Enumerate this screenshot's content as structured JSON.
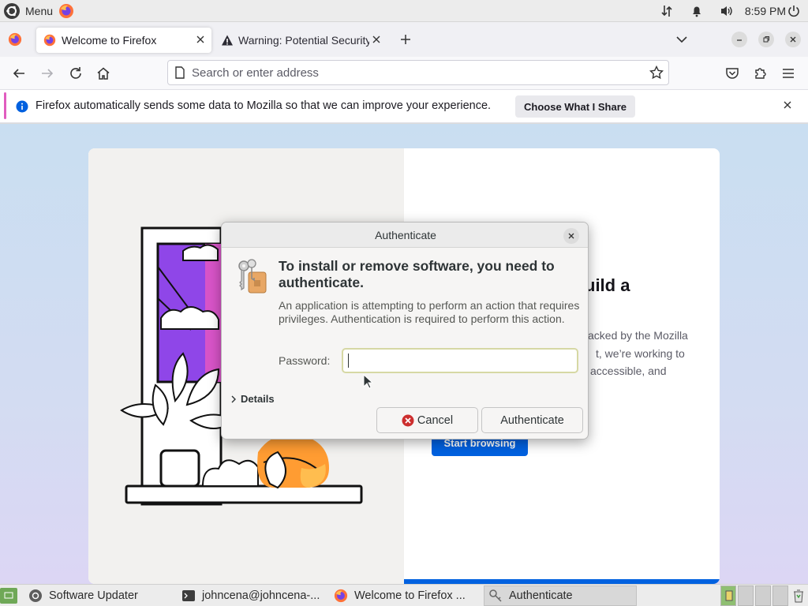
{
  "top_panel": {
    "menu_label": "Menu",
    "clock": "8:59 PM",
    "icons": [
      "ubuntu-menu-icon",
      "firefox-icon",
      "network-icon",
      "notification-bell-icon",
      "volume-icon",
      "power-icon"
    ]
  },
  "tabs": [
    {
      "title": "Welcome to Firefox",
      "active": true,
      "icon": "firefox-icon"
    },
    {
      "title": "Warning: Potential Security Risk Ahead",
      "active": false,
      "icon": "warning-icon"
    }
  ],
  "nav": {
    "url_placeholder": "Search or enter address"
  },
  "notification": {
    "message": "Firefox automatically sends some data to Mozilla so that we can improve your experience.",
    "button": "Choose What I Share"
  },
  "welcome_page": {
    "heading_fragment": "uild a",
    "body_lines": [
      "acked by the Mozilla",
      "t, we’re working to",
      "accessible, and"
    ],
    "start_button": "Start browsing"
  },
  "dialog": {
    "title": "Authenticate",
    "heading": "To install or remove software, you need to authenticate.",
    "description": "An application is attempting to perform an action that requires privileges. Authentication is required to perform this action.",
    "password_label": "Password:",
    "password_value": "",
    "details_label": "Details",
    "cancel_label": "Cancel",
    "authenticate_label": "Authenticate"
  },
  "taskbar": {
    "items": [
      {
        "label": "Software Updater",
        "active": false
      },
      {
        "label": "johncena@johncena-...",
        "active": false
      },
      {
        "label": "Welcome to Firefox ...",
        "active": false
      },
      {
        "label": "Authenticate",
        "active": true
      }
    ]
  },
  "colors": {
    "accent_blue": "#0061e0",
    "notification_accent": "#e15cbf",
    "cancel_icon_red": "#cc2e2e"
  }
}
